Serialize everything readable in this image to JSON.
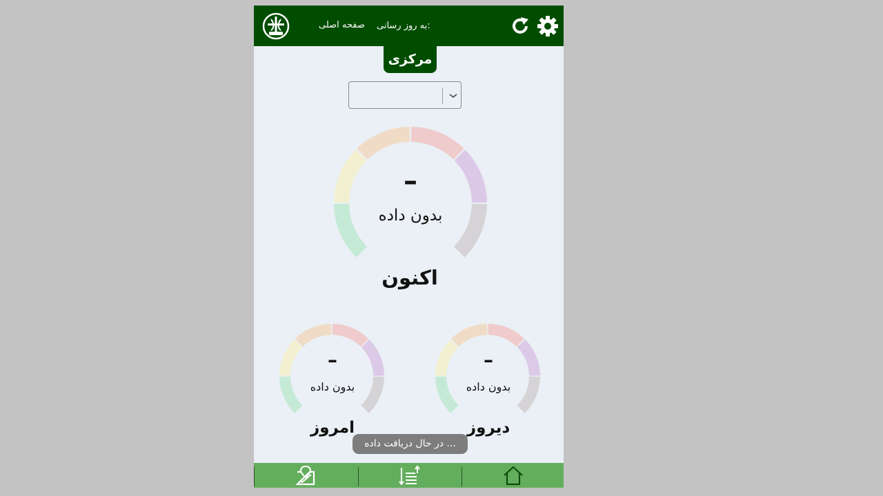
{
  "header": {
    "home_title": "صفحه اصلی",
    "update_label": "به روز رسانی:"
  },
  "station": {
    "name": "مرکزی",
    "selected": ""
  },
  "gauges": {
    "now": {
      "value": "–",
      "status": "بدون داده",
      "label": "اکنون",
      "level": null
    },
    "today": {
      "value": "–",
      "status": "بدون داده",
      "label": "امروز",
      "level": null
    },
    "yesterday": {
      "value": "–",
      "status": "بدون داده",
      "label": "دیروز",
      "level": null
    }
  },
  "scale_colors": [
    "#c4ead6",
    "#f3f0d2",
    "#f0dcc6",
    "#f0cbcb",
    "#dbc9e7",
    "#d5d3d5"
  ],
  "toast": "در حال دریافت داده ...",
  "nav": {
    "left_icon": "map-check-icon",
    "center_icon": "sort-list-icon",
    "right_icon": "home-icon"
  },
  "colors": {
    "header": "#004d00",
    "nav": "#63ae5c",
    "background": "#eaf0f5"
  }
}
